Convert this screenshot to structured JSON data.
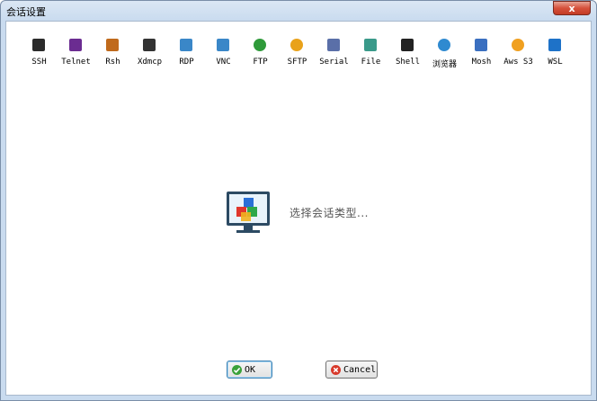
{
  "window": {
    "title": "会话设置",
    "close_label": "x"
  },
  "toolbar": {
    "items": [
      {
        "label": "SSH",
        "icon": "ssh-wrench-icon",
        "color": "#2b2b2b"
      },
      {
        "label": "Telnet",
        "icon": "telnet-icon",
        "color": "#6b2c91"
      },
      {
        "label": "Rsh",
        "icon": "rsh-icon",
        "color": "#c06a1c"
      },
      {
        "label": "Xdmcp",
        "icon": "xdmcp-x-icon",
        "color": "#333333"
      },
      {
        "label": "RDP",
        "icon": "rdp-monitor-icon",
        "color": "#3a87c8"
      },
      {
        "label": "VNC",
        "icon": "vnc-monitor-icon",
        "color": "#3a87c8"
      },
      {
        "label": "FTP",
        "icon": "ftp-globe-icon",
        "color": "#2f9a3a"
      },
      {
        "label": "SFTP",
        "icon": "sftp-globe-icon",
        "color": "#e9a21a"
      },
      {
        "label": "Serial",
        "icon": "serial-plug-icon",
        "color": "#5a6fa8"
      },
      {
        "label": "File",
        "icon": "file-monitor-icon",
        "color": "#3a9a8a"
      },
      {
        "label": "Shell",
        "icon": "shell-terminal-icon",
        "color": "#222222"
      },
      {
        "label": "浏览器",
        "icon": "browser-globe-icon",
        "color": "#2f8ad0"
      },
      {
        "label": "Mosh",
        "icon": "mosh-satellite-icon",
        "color": "#3a6fc0"
      },
      {
        "label": "Aws S3",
        "icon": "aws-s3-icon",
        "color": "#f0a020"
      },
      {
        "label": "WSL",
        "icon": "wsl-windows-icon",
        "color": "#1e72c8"
      }
    ]
  },
  "main": {
    "hint": "选择会话类型..."
  },
  "buttons": {
    "ok_label": "OK",
    "cancel_label": "Cancel"
  }
}
